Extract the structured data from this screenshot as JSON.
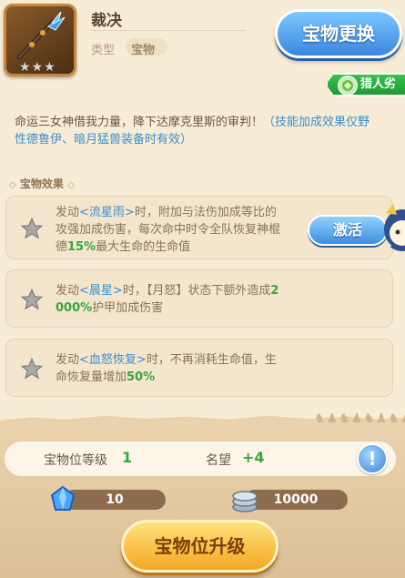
{
  "item": {
    "name": "裁决",
    "type_label": "类型",
    "type_value": "宝物",
    "stars": 3
  },
  "header": {
    "change_button": "宝物更换",
    "hunter_tag": "猎人劣"
  },
  "description": {
    "main": "命运三女神借我力量，降下达摩克里斯的审判！",
    "note": "（技能加成效果仅野性德鲁伊、暗月猛兽装备时有效）"
  },
  "effects_section": {
    "title": "宝物效果"
  },
  "effects": [
    {
      "line1_pre": "发动",
      "line1_skill": "<流星雨>",
      "line1_post": "时，附加与法伤加成等比的",
      "line2": "攻强加成伤害，每次命中时令全队恢复神棍",
      "line3_pre": "德",
      "line3_value": "15%",
      "line3_post": "最大生命的生命值"
    },
    {
      "line1_pre": "发动",
      "line1_skill": "<晨星>",
      "line1_post": "时，【月怒】状态下额外造成",
      "line1_value": "2",
      "line2_value": "000%",
      "line2_post": "护甲加成伤害"
    },
    {
      "line1_pre": "发动",
      "line1_skill": "<血怒恢复>",
      "line1_post": "时，不再消耗生命值，生",
      "line2_pre": "命恢复量增加",
      "line2_value": "50%"
    }
  ],
  "activate_button": "激活",
  "stats": {
    "slot_level_label": "宝物位等级",
    "slot_level_value": "1",
    "prestige_label": "名望",
    "prestige_value": "+4",
    "info_icon": "!"
  },
  "resources": {
    "crystal": "10",
    "coins": "10000"
  },
  "upgrade_button": "宝物位升级",
  "colors": {
    "background": "#f7ecd6",
    "skill_blue": "#3a8fd0",
    "value_green": "#34a73f",
    "button_blue": "#3b86e0",
    "button_gold": "#f4a623"
  }
}
